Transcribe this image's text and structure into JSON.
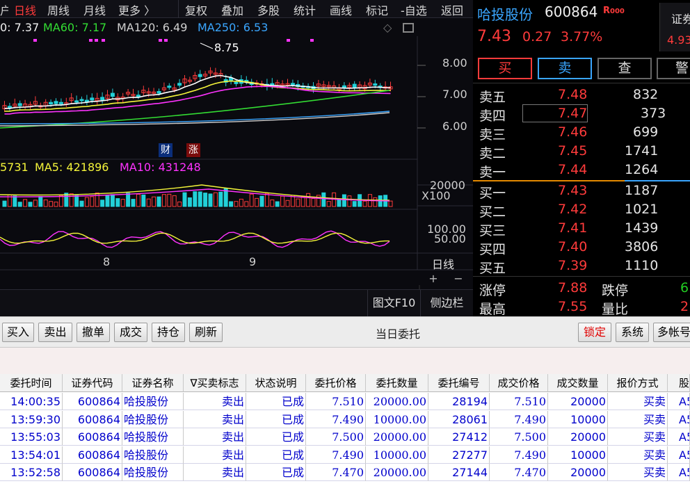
{
  "toolbar": {
    "left_tab": "户",
    "tabs": [
      {
        "label": "日线",
        "active": true
      },
      {
        "label": "周线",
        "active": false
      },
      {
        "label": "月线",
        "active": false
      },
      {
        "label": "更多 〉",
        "active": false
      }
    ],
    "tools": [
      "复权",
      "叠加",
      "多股",
      "统计",
      "画线",
      "标记",
      "-自选",
      "返回"
    ]
  },
  "chart": {
    "ma_legend": [
      {
        "text": "0: 7.37",
        "color": "#f0f0f0"
      },
      {
        "text": "MA60: 7.17",
        "color": "#33dd33"
      },
      {
        "text": "MA120: 6.49",
        "color": "#d0d0d0"
      },
      {
        "text": "MA250: 6.53",
        "color": "#3aa6ff"
      }
    ],
    "high_marker": "8.75",
    "price_axis": [
      "8.00",
      "7.00",
      "6.00"
    ],
    "fin_badge": "财",
    "zhang_badge": "涨",
    "vol_legend": [
      {
        "text": "5731",
        "color": "#f5f53a"
      },
      {
        "text": "MA5: 421896",
        "color": "#f5f53a"
      },
      {
        "text": "MA10: 431248",
        "color": "#ff33ff"
      }
    ],
    "vol_axis": "20000",
    "vol_unit": "X100",
    "ind_axis": [
      "100.00",
      "50.00"
    ],
    "date_labels": [
      "8",
      "9"
    ],
    "period_label": "日线",
    "zoom_in": "+",
    "zoom_out": "−",
    "f10_button": "图文F10",
    "sidebar_button": "侧边栏"
  },
  "quote": {
    "name": "哈投股份",
    "code": "600864",
    "badge": "R",
    "badge_sub": "000",
    "price": "7.43",
    "change": "0.27",
    "change_pct": "3.77%",
    "corner_label": "证券",
    "corner_value": "4.93",
    "actions": [
      "买",
      "卖",
      "查",
      "警"
    ],
    "sell_levels": [
      {
        "label": "卖五",
        "price": "7.48",
        "vol": "832"
      },
      {
        "label": "卖四",
        "price": "7.47",
        "vol": "373"
      },
      {
        "label": "卖三",
        "price": "7.46",
        "vol": "699"
      },
      {
        "label": "卖二",
        "price": "7.45",
        "vol": "1741"
      },
      {
        "label": "卖一",
        "price": "7.44",
        "vol": "1264"
      }
    ],
    "buy_levels": [
      {
        "label": "买一",
        "price": "7.43",
        "vol": "1187"
      },
      {
        "label": "买二",
        "price": "7.42",
        "vol": "1021"
      },
      {
        "label": "买三",
        "price": "7.41",
        "vol": "1439"
      },
      {
        "label": "买四",
        "price": "7.40",
        "vol": "3806"
      },
      {
        "label": "买五",
        "price": "7.39",
        "vol": "1110"
      }
    ],
    "stats": [
      {
        "l1": "涨停",
        "v1": "7.88",
        "l2": "跌停",
        "v2": "6"
      },
      {
        "l1": "最高",
        "v1": "7.55",
        "l2": "量比",
        "v2": "2"
      }
    ]
  },
  "trade": {
    "buttons": [
      "买入",
      "卖出",
      "撤单",
      "成交",
      "持仓",
      "刷新"
    ],
    "title": "当日委托",
    "right_buttons": [
      "锁定",
      "系统",
      "多帐号"
    ],
    "columns": [
      "委托时间",
      "证券代码",
      "证券名称",
      "∇买卖标志",
      "状态说明",
      "委托价格",
      "委托数量",
      "委托编号",
      "成交价格",
      "成交数量",
      "报价方式",
      "股"
    ],
    "rows": [
      [
        "14:00:35",
        "600864",
        "哈投股份",
        "卖出",
        "已成",
        "7.510",
        "20000.00",
        "28194",
        "7.510",
        "20000",
        "买卖",
        "A5"
      ],
      [
        "13:59:30",
        "600864",
        "哈投股份",
        "卖出",
        "已成",
        "7.490",
        "10000.00",
        "28061",
        "7.490",
        "10000",
        "买卖",
        "A5"
      ],
      [
        "13:55:03",
        "600864",
        "哈投股份",
        "卖出",
        "已成",
        "7.500",
        "20000.00",
        "27412",
        "7.500",
        "20000",
        "买卖",
        "A5"
      ],
      [
        "13:54:01",
        "600864",
        "哈投股份",
        "卖出",
        "已成",
        "7.490",
        "10000.00",
        "27277",
        "7.490",
        "10000",
        "买卖",
        "A5"
      ],
      [
        "13:52:58",
        "600864",
        "哈投股份",
        "卖出",
        "已成",
        "7.470",
        "20000.00",
        "27144",
        "7.470",
        "20000",
        "买卖",
        "A5"
      ]
    ]
  },
  "colors": {
    "up": "#ff3b3b",
    "down": "#22d0d8",
    "accent_blue": "#3aa6ff",
    "table_text": "#0000cc"
  }
}
